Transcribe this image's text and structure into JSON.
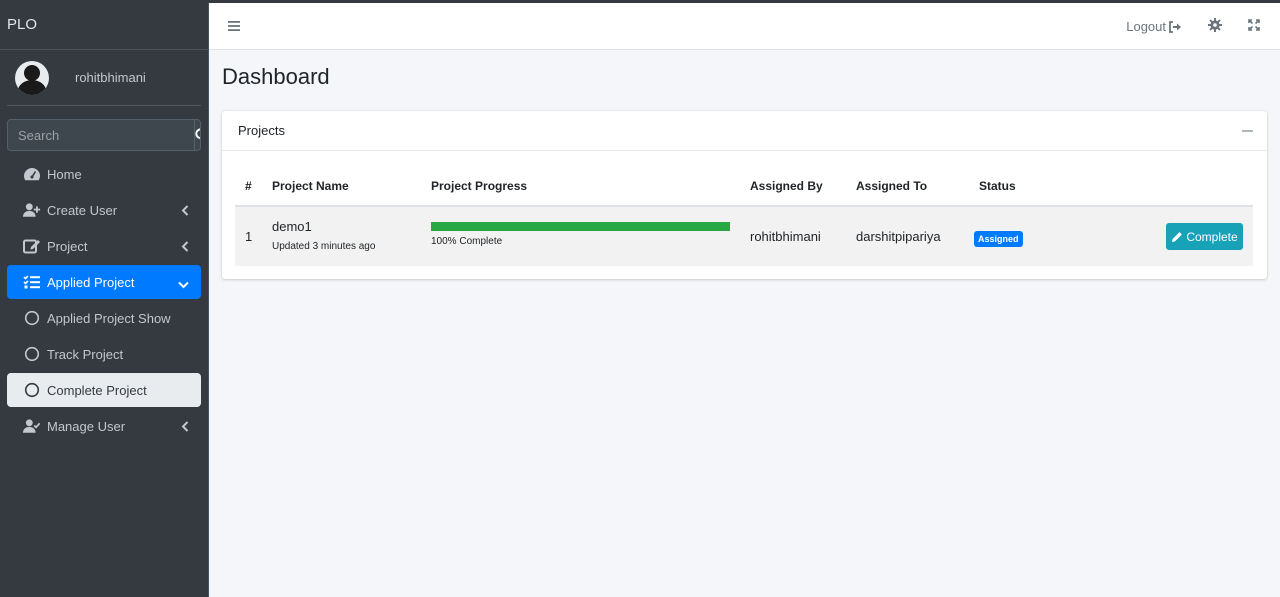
{
  "brand": "PLO",
  "user": {
    "name": "rohitbhimani"
  },
  "search": {
    "placeholder": "Search"
  },
  "nav": {
    "home": "Home",
    "create_user": "Create User",
    "project": "Project",
    "applied_project": "Applied Project",
    "applied_project_show": "Applied Project Show",
    "track_project": "Track Project",
    "complete_project": "Complete Project",
    "manage_user": "Manage User"
  },
  "topbar": {
    "logout": "Logout"
  },
  "page": {
    "title": "Dashboard"
  },
  "card": {
    "title": "Projects"
  },
  "table": {
    "headers": {
      "num": "#",
      "name": "Project Name",
      "progress": "Project Progress",
      "assigned_by": "Assigned By",
      "assigned_to": "Assigned To",
      "status": "Status"
    },
    "rows": [
      {
        "num": "1",
        "name": "demo1",
        "updated": "Updated 3 minutes ago",
        "progress_value": 100,
        "progress_text": "100% Complete",
        "assigned_by": "rohitbhimani",
        "assigned_to": "darshitpipariya",
        "status": "Assigned",
        "action": "Complete"
      }
    ]
  },
  "colors": {
    "primary": "#007bff",
    "success": "#28a745",
    "info": "#17a2b8",
    "sidebar": "#343a40"
  },
  "icons": [
    "dashboard-icon",
    "user-plus-icon",
    "edit-icon",
    "tasks-icon",
    "circle-icon",
    "user-check-icon",
    "search-icon",
    "bars-icon",
    "sign-out-icon",
    "gear-icon",
    "expand-icon",
    "pencil-icon",
    "chevron-left-icon",
    "chevron-down-icon"
  ]
}
